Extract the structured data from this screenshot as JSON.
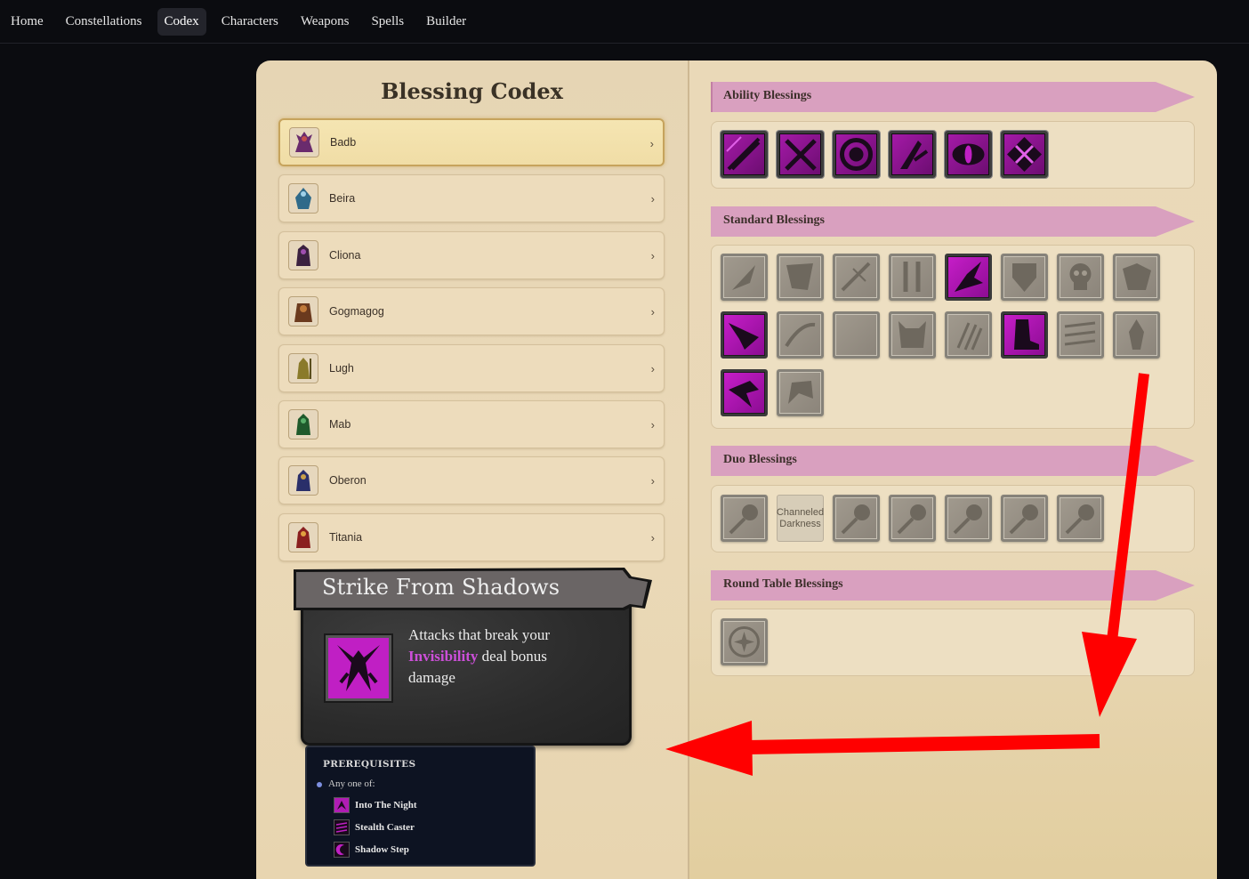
{
  "nav": {
    "items": [
      "Home",
      "Constellations",
      "Codex",
      "Characters",
      "Weapons",
      "Spells",
      "Builder"
    ],
    "active": "Codex"
  },
  "codex": {
    "title": "Blessing Codex",
    "characters": [
      {
        "name": "Badb",
        "selected": true,
        "color": "#6a2b6d"
      },
      {
        "name": "Beira",
        "selected": false,
        "color": "#2f6a8a"
      },
      {
        "name": "Cliona",
        "selected": false,
        "color": "#3b2140"
      },
      {
        "name": "Gogmagog",
        "selected": false,
        "color": "#6b3a1e"
      },
      {
        "name": "Lugh",
        "selected": false,
        "color": "#8a7a2a"
      },
      {
        "name": "Mab",
        "selected": false,
        "color": "#1f5a2c"
      },
      {
        "name": "Oberon",
        "selected": false,
        "color": "#2a2f6a"
      },
      {
        "name": "Titania",
        "selected": false,
        "color": "#8a1f1f"
      }
    ],
    "chevron": "›"
  },
  "tooltip": {
    "title": "Strike From Shadows",
    "desc_before": "Attacks that break your",
    "keyword": "Invisibility",
    "desc_after": "deal bonus damage",
    "icon": "raven-claw-icon",
    "prereq_title": "PREREQUISITES",
    "prereq_any": "Any one of:",
    "prereqs": [
      "Into The Night",
      "Stealth Caster",
      "Shadow Step"
    ]
  },
  "sections": {
    "ability": {
      "title": "Ability Blessings",
      "count": 6
    },
    "standard": {
      "title": "Standard Blessings",
      "count": 18
    },
    "duo": {
      "title": "Duo Blessings",
      "broken_label": "Channeled Darkness"
    },
    "round_table": {
      "title": "Round Table Blessings"
    }
  },
  "colors": {
    "active_magenta": "#c71ec9",
    "banner_pink": "#d89ebd",
    "arrow_red": "#ff0000"
  }
}
